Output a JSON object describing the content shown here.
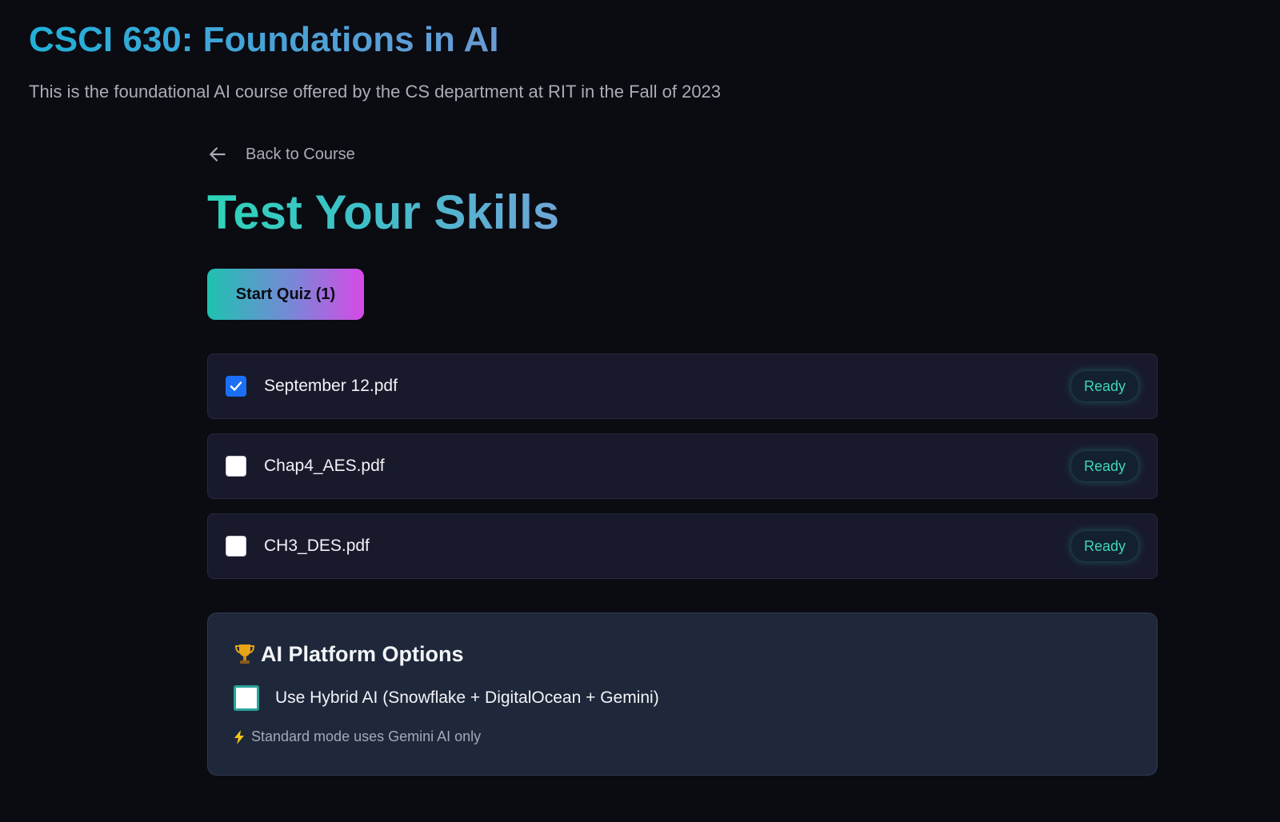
{
  "course": {
    "title": "CSCI 630: Foundations in AI",
    "description": "This is the foundational AI course offered by the CS department at RIT in the Fall of 2023"
  },
  "nav": {
    "back_label": "Back to Course",
    "back_icon": "arrow-left-icon"
  },
  "page": {
    "title": "Test Your Skills"
  },
  "actions": {
    "start_quiz_label": "Start Quiz (1)"
  },
  "files": [
    {
      "name": "September 12.pdf",
      "checked": true,
      "status": "Ready"
    },
    {
      "name": "Chap4_AES.pdf",
      "checked": false,
      "status": "Ready"
    },
    {
      "name": "CH3_DES.pdf",
      "checked": false,
      "status": "Ready"
    }
  ],
  "options": {
    "title": "AI Platform Options",
    "title_icon": "trophy-icon",
    "hybrid_label": "Use Hybrid AI (Snowflake + DigitalOcean + Gemini)",
    "hybrid_checked": false,
    "hint": "Standard mode uses Gemini AI only",
    "hint_icon": "lightning-icon"
  },
  "colors": {
    "background": "#0b0b12",
    "accent_teal": "#2dd4b8",
    "accent_purple": "#d64ae6",
    "checkbox_blue": "#1a6ff5",
    "ready_text": "#3fd6bb"
  }
}
